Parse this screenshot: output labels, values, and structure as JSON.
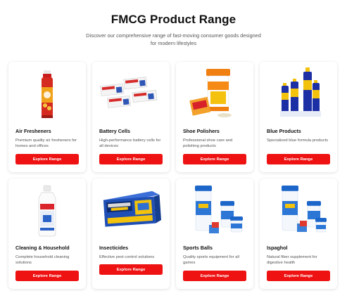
{
  "header": {
    "title": "FMCG Product Range",
    "subtitle": "Discover our comprehensive range of fast-moving consumer goods designed for modern lifestyles"
  },
  "products": [
    {
      "title": "Air Fresheners",
      "description": "Premium quality air fresheners for homes and offices",
      "button": "Explore Range",
      "image_icon": "air-freshener-can-icon"
    },
    {
      "title": "Battery Cells",
      "description": "High-performance battery cells for all devices",
      "button": "Explore Range",
      "image_icon": "battery-packs-icon"
    },
    {
      "title": "Shoe Polishers",
      "description": "Professional shoe care and polishing products",
      "button": "Explore Range",
      "image_icon": "shoe-polish-jar-icon"
    },
    {
      "title": "Blue Products",
      "description": "Specialized blue formula products",
      "button": "Explore Range",
      "image_icon": "blue-bottles-icon"
    },
    {
      "title": "Cleaning & Household",
      "description": "Complete household cleaning solutions",
      "button": "Explore Range",
      "image_icon": "cleaning-bottle-icon"
    },
    {
      "title": "Insecticides",
      "description": "Effective pest control solutions",
      "button": "Explore Range",
      "image_icon": "insecticide-mats-box-icon"
    },
    {
      "title": "Sports Balls",
      "description": "Quality sports equipment for all games",
      "button": "Explore Range",
      "image_icon": "jars-icon"
    },
    {
      "title": "Ispaghol",
      "description": "Natural fiber supplement for digestive health",
      "button": "Explore Range",
      "image_icon": "ispaghol-jars-icon"
    }
  ],
  "colors": {
    "accent": "#ee1212",
    "title": "#111111",
    "text": "#555555",
    "card_bg": "#ffffff"
  }
}
